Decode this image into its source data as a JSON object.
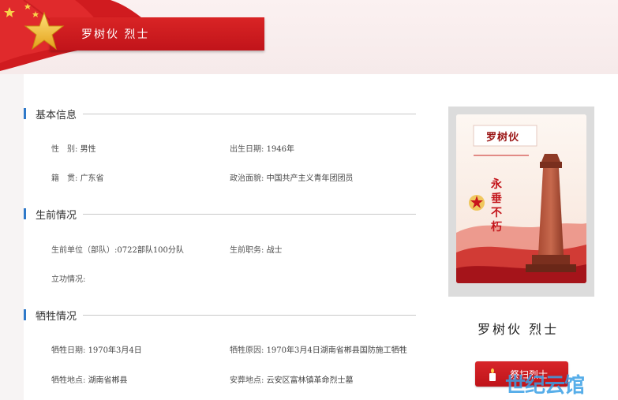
{
  "header": {
    "title": "罗树伙 烈士"
  },
  "sections": {
    "basic": {
      "title": "基本信息",
      "gender_label": "性　别:",
      "gender": "男性",
      "birth_label": "出生日期:",
      "birth": "1946年",
      "origin_label": "籍　贯:",
      "origin": "广东省",
      "politics_label": "政治面貌:",
      "politics": "中国共产主义青年团团员"
    },
    "life": {
      "title": "生前情况",
      "unit_label": "生前单位（部队）:",
      "unit": "0722部队100分队",
      "duty_label": "生前职务:",
      "duty": "战士",
      "merit_label": "立功情况:",
      "merit": ""
    },
    "sacrifice": {
      "title": "牺牲情况",
      "date_label": "牺牲日期:",
      "date": "1970年3月4日",
      "reason_label": "牺牲原因:",
      "reason": "1970年3月4日湖南省郴县国防施工牺牲",
      "place_label": "牺牲地点:",
      "place": "湖南省郴县",
      "burial_label": "安葬地点:",
      "burial": "云安区富林镇革命烈士墓"
    }
  },
  "portrait": {
    "name": "罗树伙",
    "motto": "永垂不朽"
  },
  "hero_name": "罗树伙 烈士",
  "tribute_button": "祭扫烈士",
  "watermark": "世纪云馆",
  "colors": {
    "primary_red": "#c8161d",
    "section_marker": "#2f79c9",
    "watermark_1": "#3aa0e6",
    "watermark_2": "#f2a12a"
  },
  "icons": {
    "title": "red-star-icon",
    "tribute": "candle-icon"
  }
}
